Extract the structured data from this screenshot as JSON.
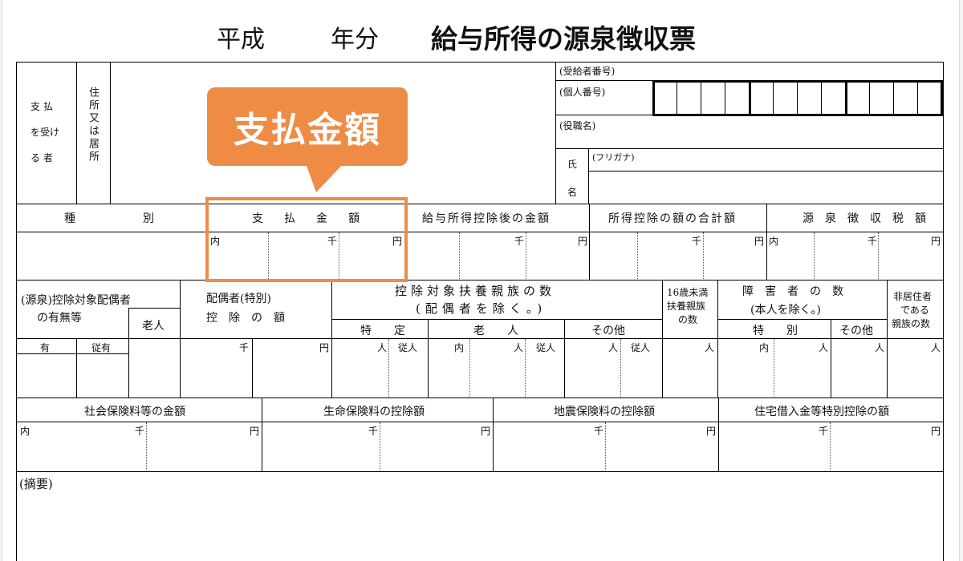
{
  "title": {
    "era": "平成",
    "year_suffix": "年分",
    "main": "給与所得の源泉徴収票"
  },
  "callout": {
    "label": "支払金額"
  },
  "recipient": {
    "header_chars": [
      "支払",
      "を受け",
      "る 者"
    ],
    "address_label": "住所又は居所",
    "recipient_no": "(受給者番号)",
    "my_number": "(個人番号)",
    "position": "(役職名)",
    "name_chars": [
      "氏",
      "名"
    ],
    "furigana": "(フリガナ)"
  },
  "row1": {
    "kind": "種　　　　　　別",
    "payment": "支　払　金　額",
    "after_deduction": "給与所得控除後の金額",
    "total_deduction": "所得控除の額の合計額",
    "tax": "源　泉　徴　収　税　額"
  },
  "units": {
    "inner": "内",
    "thousand": "千",
    "yen": "円",
    "person": "人",
    "jyunin": "従人",
    "yu": "有",
    "jyuyu": "従有"
  },
  "row2": {
    "spouse_line1": "(源泉)控除対象配偶者",
    "spouse_line2": "の有無等",
    "elderly": "老人",
    "special_line1": "配偶者(特別)",
    "special_line2": "控　除　の　額",
    "dependents_line1": "控除対象扶養親族の数",
    "dependents_line2": "(配偶者を除く。)",
    "dep_special": "特　　定",
    "dep_elderly": "老　　人",
    "dep_other": "その他",
    "under16": [
      "16歳未満",
      "扶養親族",
      "の数"
    ],
    "disabled_line1": "障　害　者　の　数",
    "disabled_line2": "(本人を除く。)",
    "dis_special": "特　　別",
    "dis_other": "その他",
    "nonresident": [
      "非居住者",
      "である",
      "親族の数"
    ]
  },
  "row3": {
    "social": "社会保険料等の金額",
    "life": "生命保険料の控除額",
    "quake": "地震保険料の控除額",
    "housing": "住宅借入金等特別控除の額"
  },
  "remarks": "(摘要)",
  "colors": {
    "accent": "#ee8c45",
    "line": "#000000"
  }
}
